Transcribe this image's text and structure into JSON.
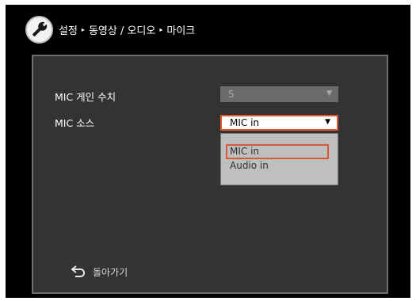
{
  "header": {
    "breadcrumb": [
      "설정",
      "동영상 / 오디오",
      "마이크"
    ],
    "separator": "▸",
    "icon": "wrench-icon"
  },
  "settings": {
    "gain": {
      "label": "MIC 게인 수치",
      "value": "5",
      "enabled": false
    },
    "source": {
      "label": "MIC 소스",
      "value": "MIC in",
      "options": [
        "MIC in",
        "Audio in"
      ],
      "highlighted_option": "MIC in"
    }
  },
  "footer": {
    "back_label": "돌아가기",
    "back_icon": "return-arrow-icon"
  },
  "colors": {
    "highlight": "#e05a2b",
    "panel_bg": "#333333",
    "list_bg": "#bfbfbf"
  }
}
